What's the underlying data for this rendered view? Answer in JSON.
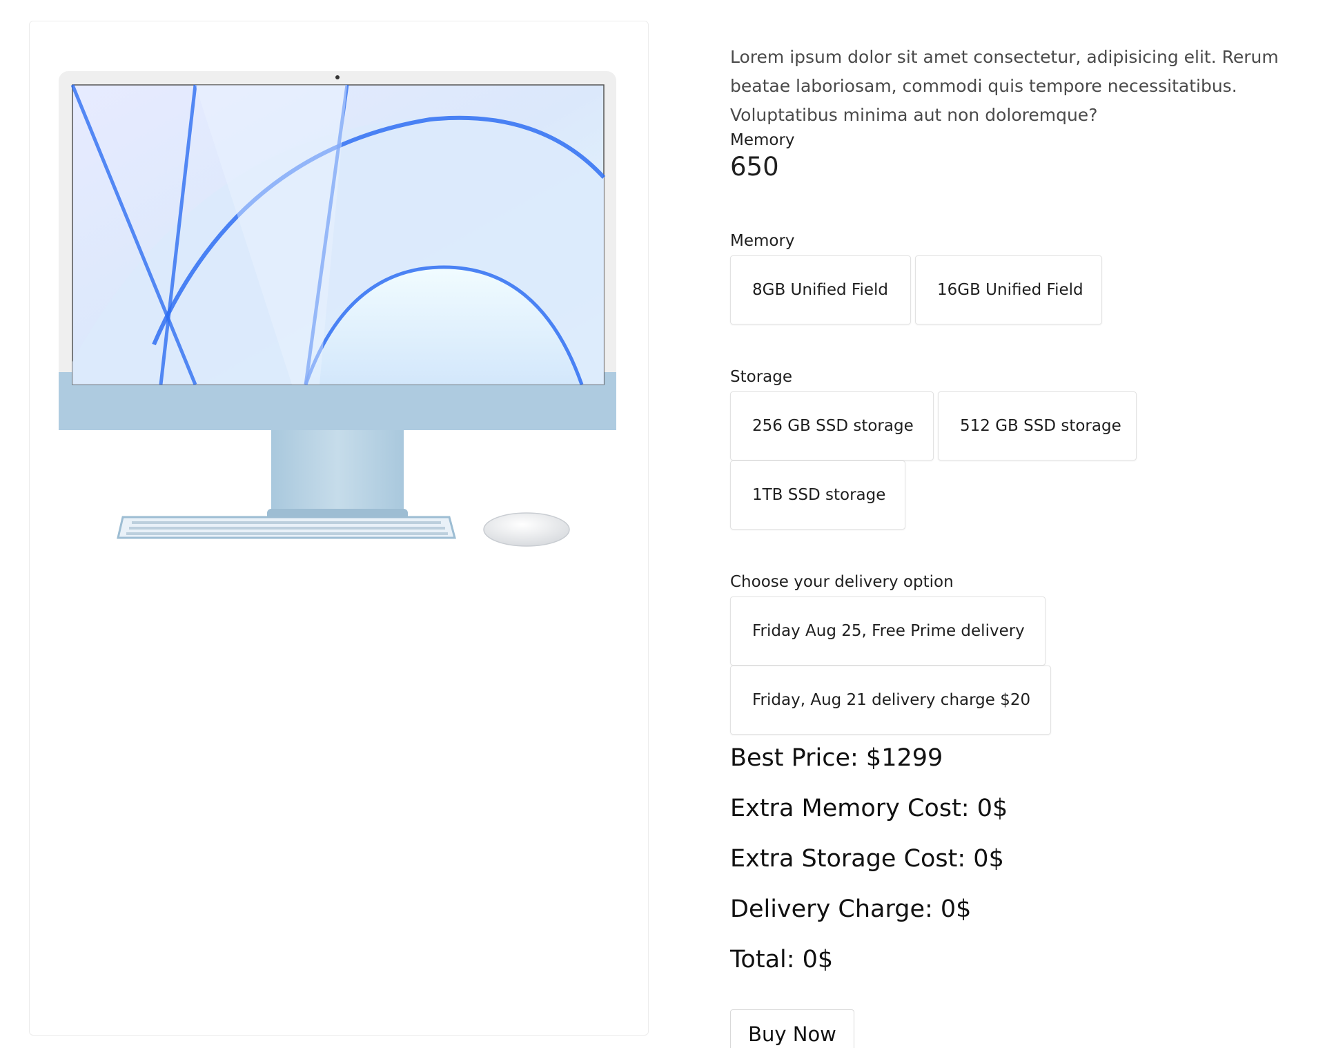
{
  "product": {
    "image_icon": "imac-product-image-icon",
    "description": "Lorem ipsum dolor sit amet consectetur, adipisicing elit. Rerum beatae laboriosam, commodi quis tempore necessitatibus. Voluptatibus minima aut non doloremque?",
    "memory_label": "Memory",
    "memory_value": "650"
  },
  "memory": {
    "label": "Memory",
    "options": [
      "8GB Unified Field",
      "16GB Unified Field"
    ]
  },
  "storage": {
    "label": "Storage",
    "options": [
      "256 GB SSD storage",
      "512 GB SSD storage",
      "1TB SSD storage"
    ]
  },
  "delivery": {
    "label": "Choose your delivery option",
    "options": [
      "Friday Aug 25, Free Prime delivery",
      "Friday, Aug 21 delivery charge $20"
    ]
  },
  "summary": {
    "best_price": "Best Price: $1299",
    "extra_memory": "Extra Memory Cost: 0$",
    "extra_storage": "Extra Storage Cost: 0$",
    "delivery_charge": "Delivery Charge: 0$",
    "total": "Total: 0$"
  },
  "buy_button": "Buy Now",
  "colors": {
    "imac_blue": "#aecbe0",
    "screen_bg": "#dfe9fb",
    "arc_blue": "#2f6ff2",
    "border": "#e2e2e2"
  }
}
